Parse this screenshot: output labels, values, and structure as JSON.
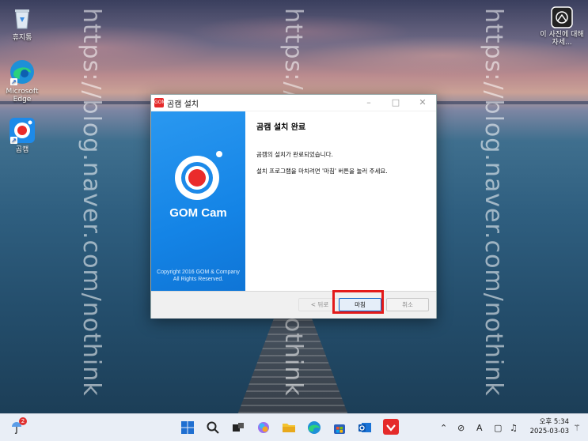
{
  "desktop": {
    "icons": [
      {
        "label": "휴지통",
        "icon": "recycle-bin-icon"
      },
      {
        "label": "Microsoft Edge",
        "icon": "edge-icon"
      },
      {
        "label": "곰캠",
        "icon": "gomcam-icon"
      }
    ],
    "spotlight_label": "이 사진에 대해 자세...",
    "watermark": "https://blog.naver.com/nothink"
  },
  "installer": {
    "title": "곰캠 설치",
    "heading": "곰캠 설치 완료",
    "message1": "곰캠의 설치가 완료되었습니다.",
    "message2": "설치 프로그램을 마치려면 '마침' 버튼을 눌러 주세요.",
    "brand": "GOM Cam",
    "copyright_line1": "Copyright 2016 GOM & Company",
    "copyright_line2": "All Rights Reserved.",
    "back_label": "< 뒤로",
    "finish_label": "마침",
    "cancel_label": "취소",
    "window_controls": [
      "minimize-icon",
      "maximize-icon",
      "close-icon"
    ]
  },
  "taskbar": {
    "weather_badge": "2",
    "apps": [
      "start-icon",
      "search-icon",
      "task-view-icon",
      "copilot-icon",
      "file-explorer-icon",
      "edge-icon",
      "store-icon",
      "outlook-icon",
      "gomcam-icon"
    ],
    "tray_ime": "A",
    "time": "오후 5:34",
    "date": "2025-03-03",
    "colors": {
      "accent": "#0a62c7",
      "highlight": "#e31a1a",
      "gom_red": "#e52a2a"
    }
  }
}
